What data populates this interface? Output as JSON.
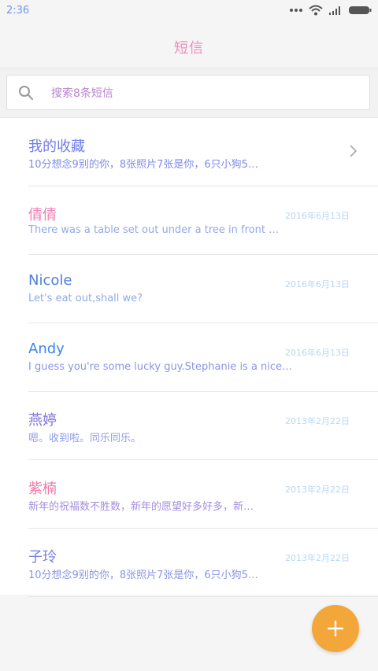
{
  "status_bar": {
    "time": "2:36"
  },
  "header": {
    "title": "短信"
  },
  "search": {
    "placeholder": "搜索8条短信"
  },
  "conversations": [
    {
      "name": "我的收藏",
      "date": "",
      "preview": "10分想念9别的你，8张照片7张是你，6只小狗5…",
      "name_color": "#6f7de8",
      "preview_color": "#7e8ce8"
    },
    {
      "name": "倩倩",
      "date": "2016年6月13日",
      "preview": "There was a table set out under a tree in front …",
      "name_color": "#f07fb4",
      "preview_color": "#92a9ea"
    },
    {
      "name": "Nicole",
      "date": "2016年6月13日",
      "preview": "Let's eat out,shall we?",
      "name_color": "#4f7ee0",
      "preview_color": "#92a9ea"
    },
    {
      "name": "Andy",
      "date": "2016年6月13日",
      "preview": "I guess you're some lucky guy.Stephanie is a nice…",
      "name_color": "#3f86e8",
      "preview_color": "#8b95e6"
    },
    {
      "name": "燕婷",
      "date": "2013年2月22日",
      "preview": "嗯。收到啦。同乐同乐。",
      "name_color": "#7d74df",
      "preview_color": "#8f9ce8"
    },
    {
      "name": "紫楠",
      "date": "2013年2月22日",
      "preview": "新年的祝福数不胜数，新年的愿望好多好多，新…",
      "name_color": "#f07aa9",
      "preview_color": "#a58fdf"
    },
    {
      "name": "子玲",
      "date": "2013年2月22日",
      "preview": "10分想念9别的你，8张照片7张是你，6只小狗5…",
      "name_color": "#7a7fe8",
      "preview_color": "#8b95e6"
    }
  ],
  "fab": {
    "icon": "plus-icon",
    "color": "#f3a73a"
  }
}
